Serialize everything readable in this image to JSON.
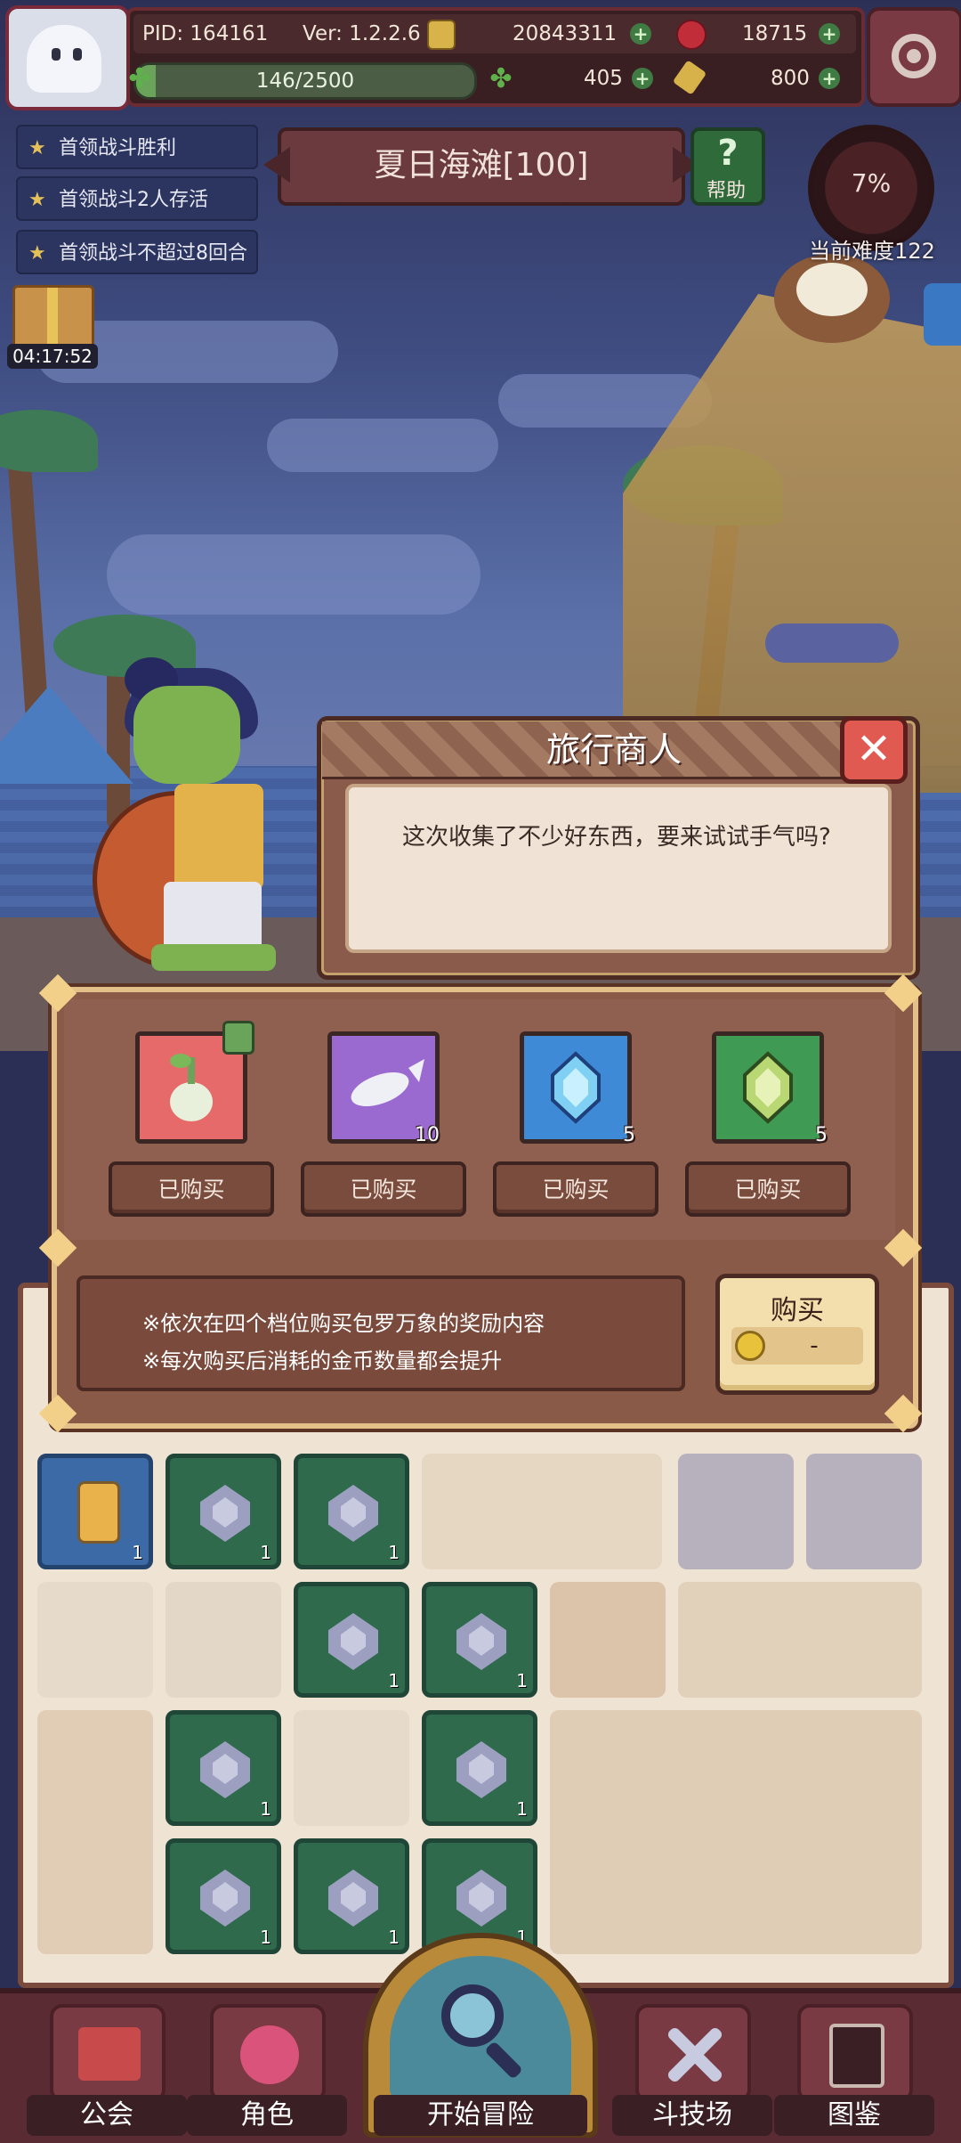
{
  "hud": {
    "pid": "PID: 164161",
    "version": "Ver: 1.2.2.6",
    "coins": "20843311",
    "gems": "18715",
    "exp": "146/2500",
    "exp_fraction": 0.0584,
    "clovers": "405",
    "keys": "800"
  },
  "quests": [
    {
      "label": "首领战斗胜利"
    },
    {
      "label": "首领战斗2人存活"
    },
    {
      "label": "首领战斗不超过8回合"
    }
  ],
  "gift": {
    "timer": "04:17:52"
  },
  "stage": {
    "title": "夏日海滩[100]",
    "help_label": "帮助"
  },
  "difficulty": {
    "percent": "7%",
    "label": "当前难度122"
  },
  "dialog": {
    "title": "旅行商人",
    "text": "这次收集了不少好东西，要来试试手气吗?"
  },
  "shop": {
    "items": [
      {
        "name": "turnip",
        "count": "",
        "status": "已购买",
        "color": "#e66a6a"
      },
      {
        "name": "fish",
        "count": "10",
        "status": "已购买",
        "color": "#9b6ad0"
      },
      {
        "name": "blue-crystal",
        "count": "5",
        "status": "已购买",
        "color": "#3e8ad6"
      },
      {
        "name": "green-crystal",
        "count": "5",
        "status": "已购买",
        "color": "#3f9a54"
      }
    ],
    "notes": [
      "※依次在四个档位购买包罗万象的奖励内容",
      "※每次购买后消耗的金币数量都会提升"
    ],
    "buy_label": "购买",
    "buy_price": "-"
  },
  "board": {
    "counts": [
      "1",
      "1",
      "1",
      "1",
      "1",
      "1",
      "1",
      "1",
      "1",
      "1"
    ]
  },
  "nav": {
    "guild": "公会",
    "character": "角色",
    "start": "开始冒险",
    "arena": "斗技场",
    "codex": "图鉴"
  }
}
